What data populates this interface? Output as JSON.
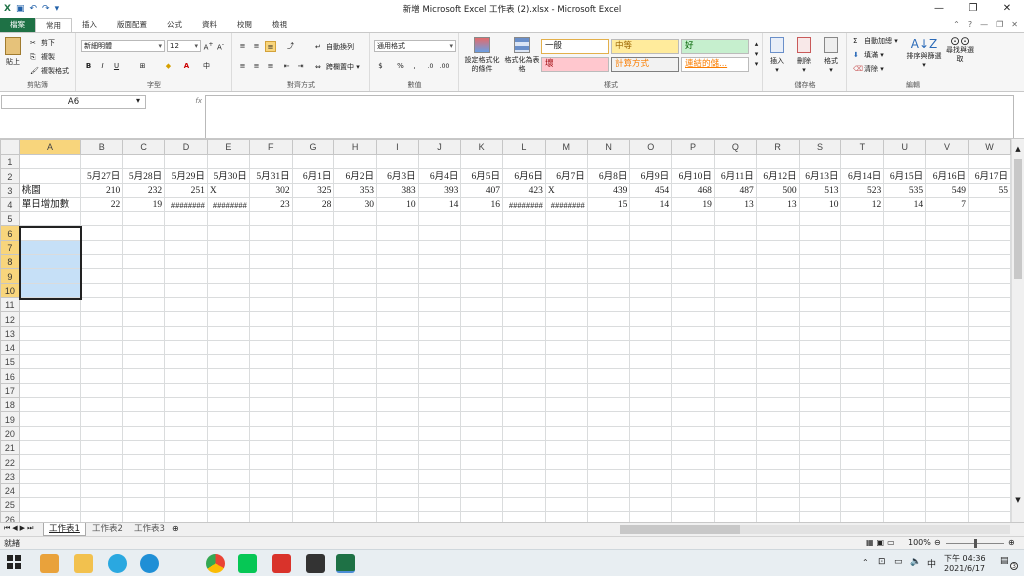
{
  "window": {
    "title": "新增 Microsoft Excel 工作表 (2).xlsx - Microsoft Excel"
  },
  "tabs": [
    "檔案",
    "常用",
    "插入",
    "版面配置",
    "公式",
    "資料",
    "校閱",
    "檢視"
  ],
  "clipboard": {
    "paste": "貼上",
    "cut": "剪下",
    "copy": "複製",
    "format_painter": "複製格式",
    "label": "剪貼簿"
  },
  "font": {
    "name": "新細明體",
    "size": "12",
    "label": "字型"
  },
  "alignment": {
    "wrap": "自動換列",
    "merge": "跨欄置中",
    "label": "對齊方式"
  },
  "number": {
    "format": "通用格式",
    "label": "數值"
  },
  "styles": {
    "conditional": "設定格式化的條件",
    "table": "格式化為表格",
    "cells": [
      "一般",
      "中等",
      "好",
      "壞",
      "計算方式",
      "連結的儲..."
    ],
    "label": "樣式"
  },
  "cells_group": {
    "insert": "插入",
    "delete": "刪除",
    "format": "格式",
    "label": "儲存格"
  },
  "editing": {
    "autosum": "自動加總",
    "fill": "填滿",
    "clear": "清除",
    "sort": "排序與篩選",
    "find": "尋找與選取",
    "label": "編輯"
  },
  "namebox": "A6",
  "fx": "fx",
  "columns": [
    "A",
    "B",
    "C",
    "D",
    "E",
    "F",
    "G",
    "H",
    "I",
    "J",
    "K",
    "L",
    "M",
    "N",
    "O",
    "P",
    "Q",
    "R",
    "S",
    "T",
    "U",
    "V",
    "W"
  ],
  "rows": {
    "r2": [
      "",
      "5月27日",
      "5月28日",
      "5月29日",
      "5月30日",
      "5月31日",
      "6月1日",
      "6月2日",
      "6月3日",
      "6月4日",
      "6月5日",
      "6月6日",
      "6月7日",
      "6月8日",
      "6月9日",
      "6月10日",
      "6月11日",
      "6月12日",
      "6月13日",
      "6月14日",
      "6月15日",
      "6月16日",
      "6月17日"
    ],
    "r3": [
      "桃園",
      "210",
      "232",
      "251",
      "X",
      "302",
      "325",
      "353",
      "383",
      "393",
      "407",
      "423",
      "X",
      "439",
      "454",
      "468",
      "487",
      "500",
      "513",
      "523",
      "535",
      "549",
      "55"
    ],
    "r4": [
      "單日增加數",
      "22",
      "19",
      "########",
      "########",
      "23",
      "28",
      "30",
      "10",
      "14",
      "16",
      "########",
      "########",
      "15",
      "14",
      "19",
      "13",
      "13",
      "10",
      "12",
      "14",
      "7",
      ""
    ]
  },
  "sheets": [
    "工作表1",
    "工作表2",
    "工作表3"
  ],
  "status": {
    "ready": "就緒",
    "zoom": "100%"
  },
  "taskbar": {
    "time": "下午 04:36",
    "date": "2021/6/17",
    "ime": "中",
    "notif": "3"
  },
  "colors": {
    "excel_green": "#1e7145",
    "selection_blue": "#c6e0f7",
    "header_highlight": "#f8d57c"
  }
}
